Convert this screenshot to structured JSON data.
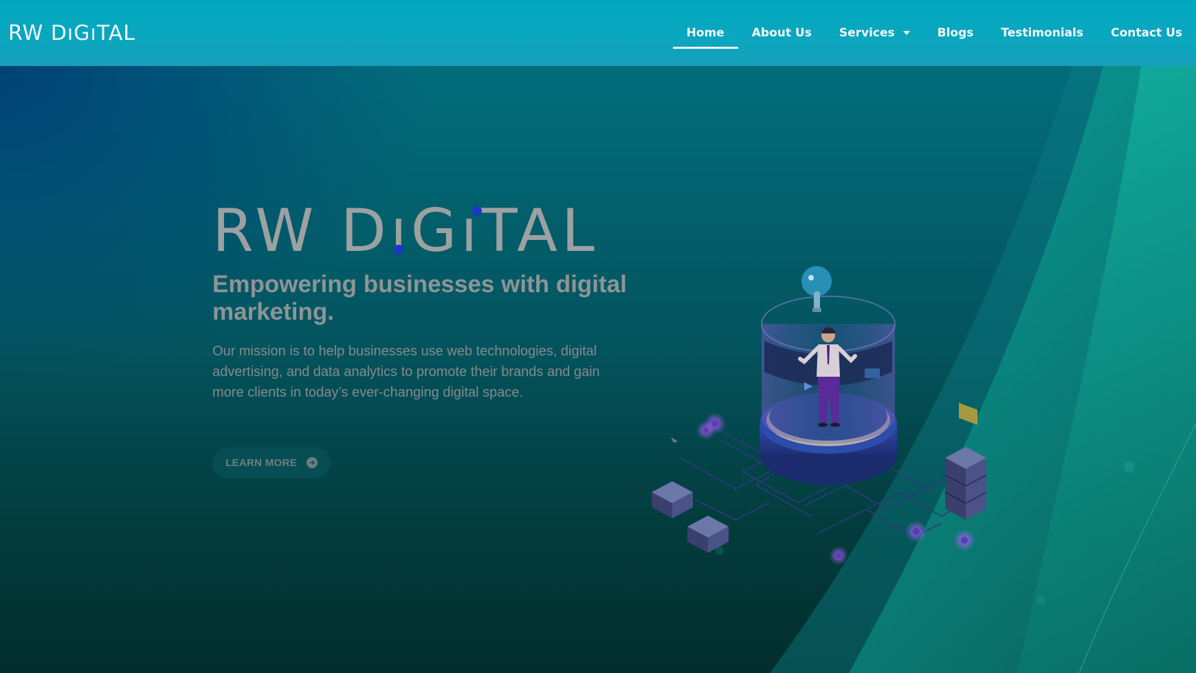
{
  "header": {
    "logo_text": "RW DıGıTAL",
    "nav": [
      {
        "label": "Home"
      },
      {
        "label": "About Us"
      },
      {
        "label": "Services"
      },
      {
        "label": "Blogs"
      },
      {
        "label": "Testimonials"
      },
      {
        "label": "Contact Us"
      }
    ]
  },
  "hero": {
    "logo_text": "RW DıGıTAL",
    "title": "Empowering businesses with digital marketing.",
    "description": "Our mission is to help businesses use web technologies, digital advertising, and data analytics to promote their brands and gain more clients in today’s ever-changing digital space.",
    "button_label": "LEARN MORE"
  },
  "colors": {
    "header_bg": "#00a8be",
    "hero_dark": "#022e2d",
    "accent_blue": "#1d38c9",
    "teal_curve": "#0fbfa6"
  },
  "icons": [
    "arrow-right-circle-icon",
    "chevron-down-icon"
  ]
}
